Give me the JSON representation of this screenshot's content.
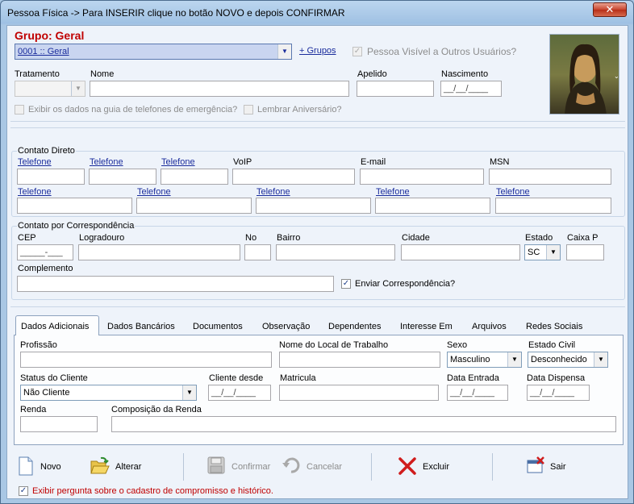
{
  "window": {
    "title": "Pessoa Física -> Para INSERIR clique no botão NOVO e depois CONFIRMAR",
    "close_glyph": "✕"
  },
  "header": {
    "group_title": "Grupo: Geral",
    "group_value": "0001 :: Geral",
    "more_groups": "+ Grupos",
    "visible_label": "Pessoa Visível a Outros Usuários?",
    "labels": {
      "tratamento": "Tratamento",
      "nome": "Nome",
      "apelido": "Apelido",
      "nascimento": "Nascimento"
    },
    "nascimento_value": "__/__/____",
    "exibir_dados": "Exibir os dados na guia de telefones de emergência?",
    "lembrar": "Lembrar Aniversário?"
  },
  "contato_direto": {
    "title": "Contato Direto",
    "row1": [
      "Telefone",
      "Telefone",
      "Telefone"
    ],
    "voip": "VoIP",
    "email": "E-mail",
    "msn": "MSN",
    "row2": [
      "Telefone",
      "Telefone",
      "Telefone",
      "Telefone",
      "Telefone"
    ]
  },
  "correspondencia": {
    "title": "Contato por Correspondência",
    "cep": "CEP",
    "cep_value": "_____-___",
    "logradouro": "Logradouro",
    "no": "No",
    "bairro": "Bairro",
    "cidade": "Cidade",
    "estado": "Estado",
    "estado_value": "SC",
    "caixa": "Caixa P",
    "complemento": "Complemento",
    "enviar": "Enviar Correspondência?"
  },
  "tabs": [
    "Dados Adicionais",
    "Dados Bancários",
    "Documentos",
    "Observação",
    "Dependentes",
    "Interesse Em",
    "Arquivos",
    "Redes Sociais"
  ],
  "dados_adicionais": {
    "profissao": "Profissão",
    "local_trabalho": "Nome do Local de Trabalho",
    "sexo": "Sexo",
    "sexo_value": "Masculino",
    "estado_civil": "Estado Civil",
    "estado_civil_value": "Desconhecido",
    "status": "Status do Cliente",
    "status_value": "Não Cliente",
    "cliente_desde": "Cliente desde",
    "date_mask": "__/__/____",
    "matricula": "Matricula",
    "data_entrada": "Data Entrada",
    "data_dispensa": "Data Dispensa",
    "renda": "Renda",
    "composicao": "Composição da Renda"
  },
  "toolbar": {
    "novo": "Novo",
    "alterar": "Alterar",
    "confirmar": "Confirmar",
    "cancelar": "Cancelar",
    "excluir": "Excluir",
    "sair": "Sair"
  },
  "footer": {
    "pergunta": "Exibir pergunta sobre o cadastro de compromisso e histórico."
  },
  "colors": {
    "accent_red": "#c00000",
    "link_blue": "#1a2c9c",
    "selection_blue": "#c9d5f0"
  }
}
